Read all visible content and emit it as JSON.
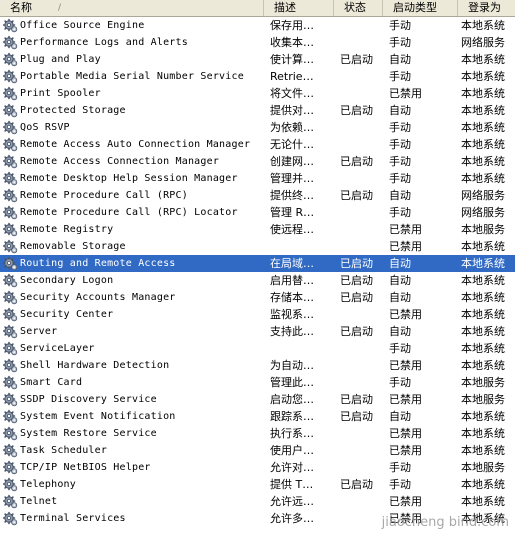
{
  "columns": {
    "name": "名称",
    "sort_indicator": "/",
    "desc": "描述",
    "status": "状态",
    "start": "启动类型",
    "logon": "登录为"
  },
  "services": [
    {
      "name": "Office Source Engine",
      "desc": "保存用…",
      "status": "",
      "start": "手动",
      "logon": "本地系统"
    },
    {
      "name": "Performance Logs and Alerts",
      "desc": "收集本…",
      "status": "",
      "start": "手动",
      "logon": "网络服务"
    },
    {
      "name": "Plug and Play",
      "desc": "使计算…",
      "status": "已启动",
      "start": "自动",
      "logon": "本地系统"
    },
    {
      "name": "Portable Media Serial Number Service",
      "desc": "Retrie…",
      "status": "",
      "start": "手动",
      "logon": "本地系统"
    },
    {
      "name": "Print Spooler",
      "desc": "将文件…",
      "status": "",
      "start": "已禁用",
      "logon": "本地系统"
    },
    {
      "name": "Protected Storage",
      "desc": "提供对…",
      "status": "已启动",
      "start": "自动",
      "logon": "本地系统"
    },
    {
      "name": "QoS RSVP",
      "desc": "为依赖…",
      "status": "",
      "start": "手动",
      "logon": "本地系统"
    },
    {
      "name": "Remote Access Auto Connection Manager",
      "desc": "无论什…",
      "status": "",
      "start": "手动",
      "logon": "本地系统"
    },
    {
      "name": "Remote Access Connection Manager",
      "desc": "创建网…",
      "status": "已启动",
      "start": "手动",
      "logon": "本地系统"
    },
    {
      "name": "Remote Desktop Help Session Manager",
      "desc": "管理并…",
      "status": "",
      "start": "手动",
      "logon": "本地系统"
    },
    {
      "name": "Remote Procedure Call (RPC)",
      "desc": "提供终…",
      "status": "已启动",
      "start": "自动",
      "logon": "网络服务"
    },
    {
      "name": "Remote Procedure Call (RPC) Locator",
      "desc": "管理 R…",
      "status": "",
      "start": "手动",
      "logon": "网络服务"
    },
    {
      "name": "Remote Registry",
      "desc": "使远程…",
      "status": "",
      "start": "已禁用",
      "logon": "本地服务"
    },
    {
      "name": "Removable Storage",
      "desc": "",
      "status": "",
      "start": "已禁用",
      "logon": "本地系统"
    },
    {
      "name": "Routing and Remote Access",
      "desc": "在局域…",
      "status": "已启动",
      "start": "自动",
      "logon": "本地系统",
      "selected": true
    },
    {
      "name": "Secondary Logon",
      "desc": "启用替…",
      "status": "已启动",
      "start": "自动",
      "logon": "本地系统"
    },
    {
      "name": "Security Accounts Manager",
      "desc": "存储本…",
      "status": "已启动",
      "start": "自动",
      "logon": "本地系统"
    },
    {
      "name": "Security Center",
      "desc": "监视系…",
      "status": "",
      "start": "已禁用",
      "logon": "本地系统"
    },
    {
      "name": "Server",
      "desc": "支持此…",
      "status": "已启动",
      "start": "自动",
      "logon": "本地系统"
    },
    {
      "name": "ServiceLayer",
      "desc": "",
      "status": "",
      "start": "手动",
      "logon": "本地系统"
    },
    {
      "name": "Shell Hardware Detection",
      "desc": "为自动…",
      "status": "",
      "start": "已禁用",
      "logon": "本地系统"
    },
    {
      "name": "Smart Card",
      "desc": "管理此…",
      "status": "",
      "start": "手动",
      "logon": "本地服务"
    },
    {
      "name": "SSDP Discovery Service",
      "desc": "启动您…",
      "status": "已启动",
      "start": "已禁用",
      "logon": "本地服务"
    },
    {
      "name": "System Event Notification",
      "desc": "跟踪系…",
      "status": "已启动",
      "start": "自动",
      "logon": "本地系统"
    },
    {
      "name": "System Restore Service",
      "desc": "执行系…",
      "status": "",
      "start": "已禁用",
      "logon": "本地系统"
    },
    {
      "name": "Task Scheduler",
      "desc": "使用户…",
      "status": "",
      "start": "已禁用",
      "logon": "本地系统"
    },
    {
      "name": "TCP/IP NetBIOS Helper",
      "desc": "允许对…",
      "status": "",
      "start": "手动",
      "logon": "本地服务"
    },
    {
      "name": "Telephony",
      "desc": "提供 T…",
      "status": "已启动",
      "start": "手动",
      "logon": "本地系统"
    },
    {
      "name": "Telnet",
      "desc": "允许远…",
      "status": "",
      "start": "已禁用",
      "logon": "本地系统"
    },
    {
      "name": "Terminal Services",
      "desc": "允许多…",
      "status": "",
      "start": "已禁用",
      "logon": "本地系统"
    }
  ],
  "watermark": "jiaocheng bind.com",
  "icon": "gear-icon"
}
